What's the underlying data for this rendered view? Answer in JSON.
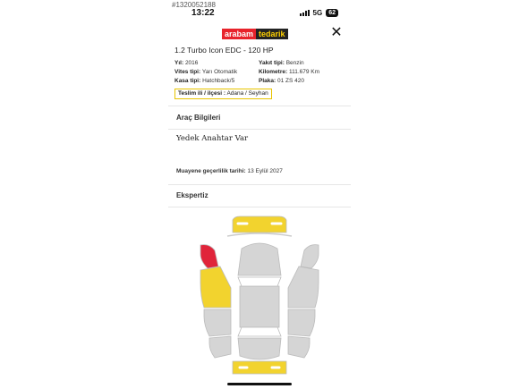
{
  "watermark": "#1320052188",
  "status": {
    "time": "13:22",
    "network": "5G",
    "battery": "62"
  },
  "header": {
    "logo_part1": "arabam",
    "logo_part2": "tedarik"
  },
  "listing": {
    "title": "1.2 Turbo Icon EDC - 120 HP",
    "specs_left": [
      {
        "key": "Yıl:",
        "value": "2016"
      },
      {
        "key": "Vites tipi:",
        "value": "Yarı Otomatik"
      },
      {
        "key": "Kasa tipi:",
        "value": "Hatchback/5"
      }
    ],
    "specs_right": [
      {
        "key": "Yakıt tipi:",
        "value": "Benzin"
      },
      {
        "key": "Kilometre:",
        "value": "111.679 Km"
      },
      {
        "key": "Plaka:",
        "value": "01 ZS 420"
      }
    ],
    "delivery_key": "Teslim ili / ilçesi :",
    "delivery_value": "Adana / Seyhan"
  },
  "sections": {
    "vehicle_info_title": "Araç Bilgileri",
    "spare_key_note": "Yedek Anahtar Var",
    "inspection_key": "Muayene geçerlilik tarihi:",
    "inspection_value": "13 Eylül 2027",
    "expertise_title": "Ekspertiz"
  },
  "expertise": {
    "parts": [
      {
        "name": "front-bumper",
        "state": "painted"
      },
      {
        "name": "left-front-fender",
        "state": "replaced"
      },
      {
        "name": "left-front-door",
        "state": "painted"
      },
      {
        "name": "rear-bumper",
        "state": "painted"
      }
    ],
    "colors": {
      "painted": "#f2d32e",
      "replaced": "#e0243a",
      "original": "#d5d5d5"
    }
  }
}
